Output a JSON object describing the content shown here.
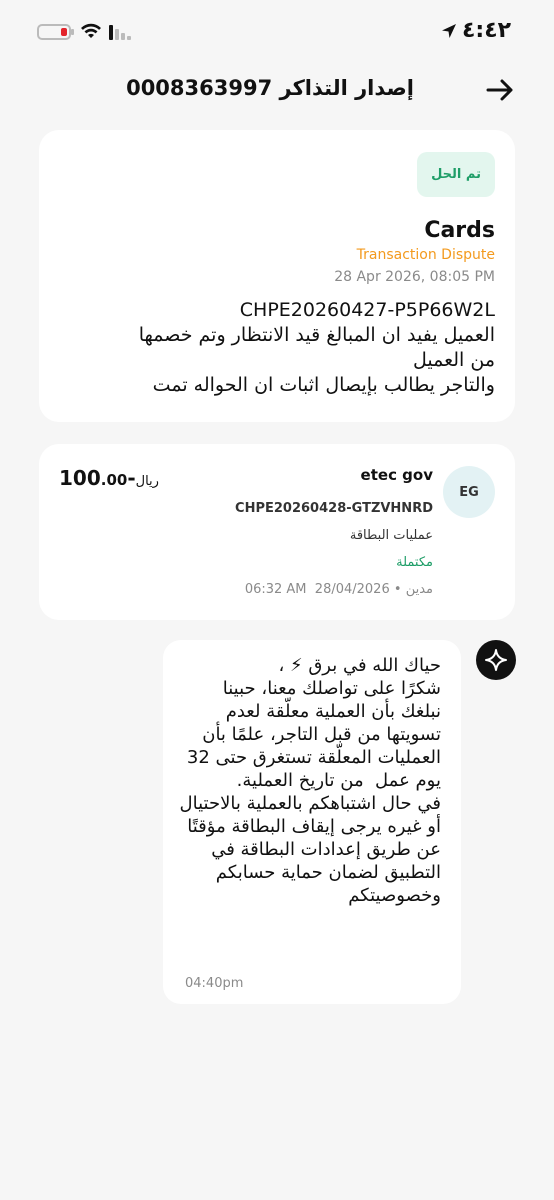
{
  "status_bar": {
    "time": "٤:٤٢",
    "battery_color": "#e3242b",
    "icons": [
      "battery-icon",
      "wifi-icon",
      "signal-icon",
      "location-arrow-icon"
    ]
  },
  "header": {
    "title": "إصدار التذاكر 0008363997",
    "back_icon": "arrow-right-icon"
  },
  "ticket": {
    "status_badge": "تم الحل",
    "title": "Cards",
    "subtitle": "Transaction Dispute",
    "date": "28 Apr 2026, 08:05 PM",
    "reference": "CHPE20260427-P5P66W2L",
    "description_lines": [
      "العميل يفيد ان المبالغ قيد الانتظار وتم خصمها",
      "من العميل",
      "والتاجر يطالب بإيصال اثبات ان الحواله تمت"
    ]
  },
  "transaction": {
    "avatar_initials": "EG",
    "merchant": "etec gov",
    "reference": "CHPE20260428-GTZVHNRD",
    "type": "عمليات البطاقة",
    "status": "مكتملة",
    "direction": "مدين",
    "separator": "•",
    "date": "28/04/2026",
    "time": "06:32 AM",
    "amount_integer": "-100",
    "amount_decimal": ".00",
    "currency": "ريال"
  },
  "message": {
    "bot_icon": "sparkle-icon",
    "text": "حياك الله في برق ⚡ ،\nشكرًا على تواصلك معنا، حبينا نبلغك بأن العملية معلّقة لعدم تسويتها من قبل التاجر، علمًا بأن العمليات المعلّقة تستغرق حتى 32 يوم عمل  من تاريخ العملية.\nفي حال اشتباهكم بالعملية بالاحتيال أو غيره يرجى إيقاف البطاقة مؤقتًا عن طريق إعدادات البطاقة في التطبيق لضمان حماية حسابكم وخصوصيتكم",
    "time": "04:40pm"
  },
  "colors": {
    "background": "#f6f6f6",
    "resolved_green": "#1f9e68",
    "dispute_orange": "#f39a1e",
    "muted_gray": "#8a8a8a"
  }
}
